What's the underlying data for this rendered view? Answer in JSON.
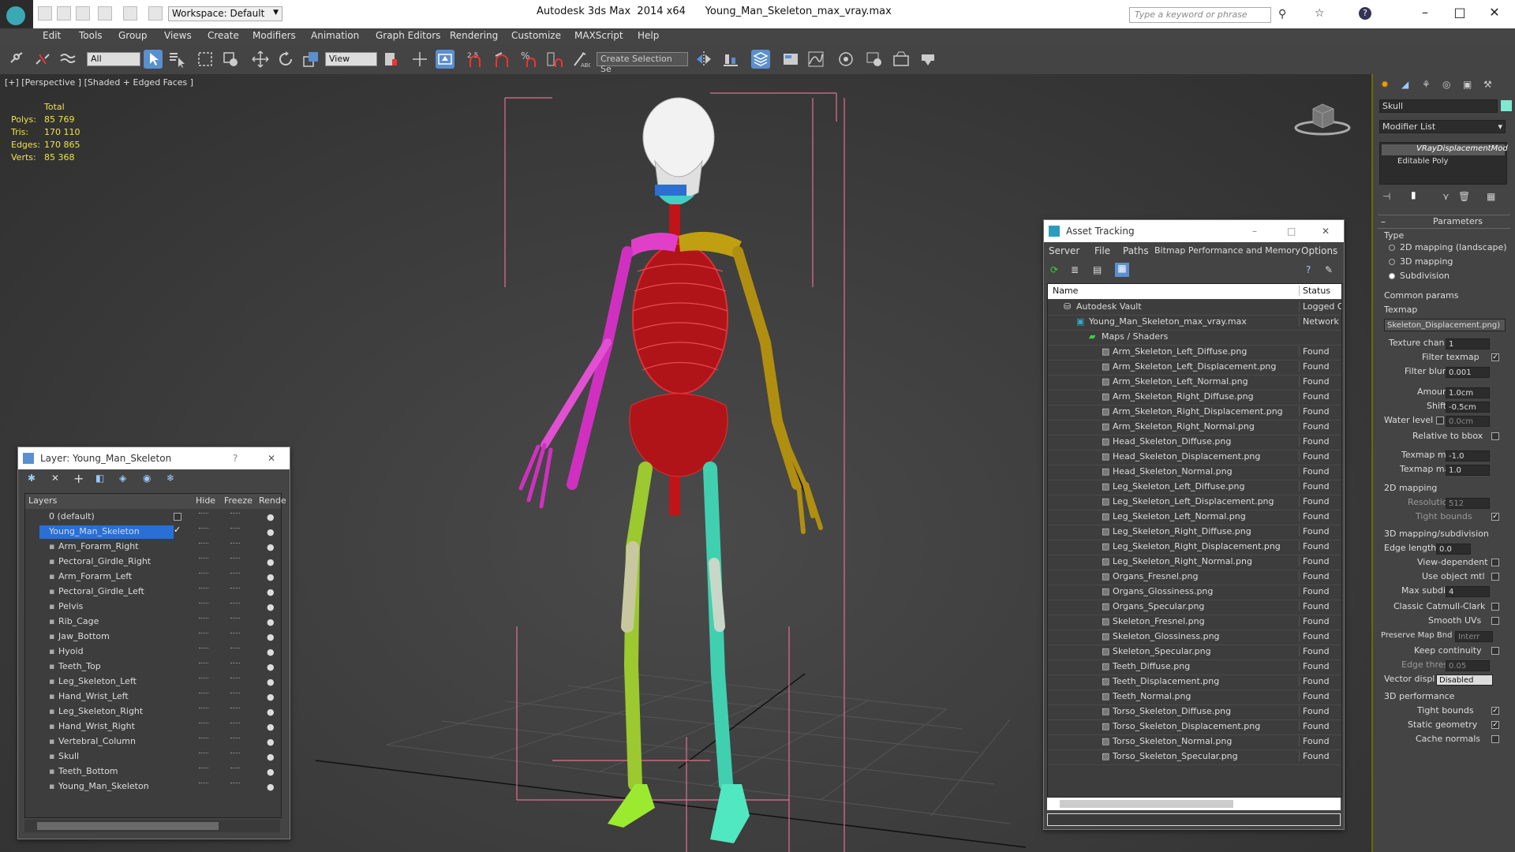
{
  "titlebar": {
    "workspace": "Workspace: Default",
    "title": "Autodesk 3ds Max  2014 x64      Young_Man_Skeleton_max_vray.max",
    "search_placeholder": "Type a keyword or phrase"
  },
  "menu": [
    "Edit",
    "Tools",
    "Group",
    "Views",
    "Create",
    "Modifiers",
    "Animation",
    "Graph Editors",
    "Rendering",
    "Customize",
    "MAXScript",
    "Help"
  ],
  "toolbar": {
    "filter_select": "All",
    "refcoord_select": "View",
    "selection_set": "Create Selection Se"
  },
  "viewport": {
    "label": "[+] [Perspective ] [Shaded + Edged Faces ]",
    "stats": {
      "total_label": "Total",
      "rows": [
        {
          "label": "Polys:",
          "value": "85 769"
        },
        {
          "label": "Tris:",
          "value": "170 110"
        },
        {
          "label": "Edges:",
          "value": "170 865"
        },
        {
          "label": "Verts:",
          "value": "85 368"
        }
      ]
    }
  },
  "layer_panel": {
    "title": "Layer: Young_Man_Skeleton",
    "help": "?",
    "columns": {
      "name": "Layers",
      "hide": "Hide",
      "freeze": "Freeze",
      "render": "Rende"
    },
    "default_layer": "0 (default)",
    "selected_layer": "Young_Man_Skeleton",
    "objects": [
      "Arm_Forarm_Right",
      "Pectoral_Girdle_Right",
      "Arm_Forarm_Left",
      "Pectoral_Girdle_Left",
      "Pelvis",
      "Rib_Cage",
      "Jaw_Bottom",
      "Hyoid",
      "Teeth_Top",
      "Leg_Skeleton_Left",
      "Hand_Wrist_Left",
      "Leg_Skeleton_Right",
      "Hand_Wrist_Right",
      "Vertebral_Column",
      "Skull",
      "Teeth_Bottom",
      "Young_Man_Skeleton"
    ]
  },
  "asset_panel": {
    "title": "Asset Tracking",
    "menu": [
      "Server",
      "File",
      "Paths",
      "Bitmap Performance and Memory",
      "Options"
    ],
    "columns": {
      "name": "Name",
      "status": "Status"
    },
    "vault": {
      "name": "Autodesk Vault",
      "status": "Logged O"
    },
    "file": {
      "name": "Young_Man_Skeleton_max_vray.max",
      "status": "Network"
    },
    "maps_folder": "Maps / Shaders",
    "maps": [
      {
        "name": "Arm_Skeleton_Left_Diffuse.png",
        "status": "Found"
      },
      {
        "name": "Arm_Skeleton_Left_Displacement.png",
        "status": "Found"
      },
      {
        "name": "Arm_Skeleton_Left_Normal.png",
        "status": "Found"
      },
      {
        "name": "Arm_Skeleton_Right_Diffuse.png",
        "status": "Found"
      },
      {
        "name": "Arm_Skeleton_Right_Displacement.png",
        "status": "Found"
      },
      {
        "name": "Arm_Skeleton_Right_Normal.png",
        "status": "Found"
      },
      {
        "name": "Head_Skeleton_Diffuse.png",
        "status": "Found"
      },
      {
        "name": "Head_Skeleton_Displacement.png",
        "status": "Found"
      },
      {
        "name": "Head_Skeleton_Normal.png",
        "status": "Found"
      },
      {
        "name": "Leg_Skeleton_Left_Diffuse.png",
        "status": "Found"
      },
      {
        "name": "Leg_Skeleton_Left_Displacement.png",
        "status": "Found"
      },
      {
        "name": "Leg_Skeleton_Left_Normal.png",
        "status": "Found"
      },
      {
        "name": "Leg_Skeleton_Right_Diffuse.png",
        "status": "Found"
      },
      {
        "name": "Leg_Skeleton_Right_Displacement.png",
        "status": "Found"
      },
      {
        "name": "Leg_Skeleton_Right_Normal.png",
        "status": "Found"
      },
      {
        "name": "Organs_Fresnel.png",
        "status": "Found"
      },
      {
        "name": "Organs_Glossiness.png",
        "status": "Found"
      },
      {
        "name": "Organs_Specular.png",
        "status": "Found"
      },
      {
        "name": "Skeleton_Fresnel.png",
        "status": "Found"
      },
      {
        "name": "Skeleton_Glossiness.png",
        "status": "Found"
      },
      {
        "name": "Skeleton_Specular.png",
        "status": "Found"
      },
      {
        "name": "Teeth_Diffuse.png",
        "status": "Found"
      },
      {
        "name": "Teeth_Displacement.png",
        "status": "Found"
      },
      {
        "name": "Teeth_Normal.png",
        "status": "Found"
      },
      {
        "name": "Torso_Skeleton_Diffuse.png",
        "status": "Found"
      },
      {
        "name": "Torso_Skeleton_Displacement.png",
        "status": "Found"
      },
      {
        "name": "Torso_Skeleton_Normal.png",
        "status": "Found"
      },
      {
        "name": "Torso_Skeleton_Specular.png",
        "status": "Found"
      }
    ]
  },
  "command_panel": {
    "object_name": "Skull",
    "modifier_list": "Modifier List",
    "stack": [
      "VRayDisplacementMod",
      "Editable Poly"
    ],
    "rollout": "Parameters",
    "type_label": "Type",
    "type_options": [
      "2D mapping (landscape)",
      "3D mapping",
      "Subdivision"
    ],
    "common_params": "Common params",
    "texmap_label": "Texmap",
    "texmap_value": "Skeleton_Displacement.png)",
    "texture_chan_label": "Texture chan",
    "texture_chan": "1",
    "filter_texmap": "Filter texmap",
    "filter_blur_label": "Filter blur",
    "filter_blur": "0.001",
    "amount_label": "Amount",
    "amount": "1.0cm",
    "shift_label": "Shift",
    "shift": "-0.5cm",
    "water_level_label": "Water level",
    "water_level": "0.0cm",
    "relative_bbox": "Relative to bbox",
    "texmap_min_label": "Texmap min",
    "texmap_min": "-1.0",
    "texmap_max_label": "Texmap max",
    "texmap_max": "1.0",
    "mapping2d": "2D mapping",
    "resolution_label": "Resolution",
    "resolution": "512",
    "tight_bounds": "Tight bounds",
    "mapping3d": "3D mapping/subdivision",
    "edge_length_label": "Edge length",
    "edge_length": "0.0",
    "view_dependent": "View-dependent",
    "use_object_mtl": "Use object mtl",
    "max_subdivs_label": "Max subdivs",
    "max_subdivs": "4",
    "catmull": "Classic Catmull-Clark",
    "smooth_uvs": "Smooth UVs",
    "preserve_map_label": "Preserve Map Bnd",
    "preserve_map": "Interr",
    "keep_continuity": "Keep continuity",
    "edge_thresh_label": "Edge thresh",
    "edge_thresh": "0.05",
    "vector_displ_label": "Vector displ",
    "vector_displ": "Disabled",
    "perf": "3D performance",
    "perf_tight": "Tight bounds",
    "static_geom": "Static geometry",
    "cache_normals": "Cache normals"
  }
}
